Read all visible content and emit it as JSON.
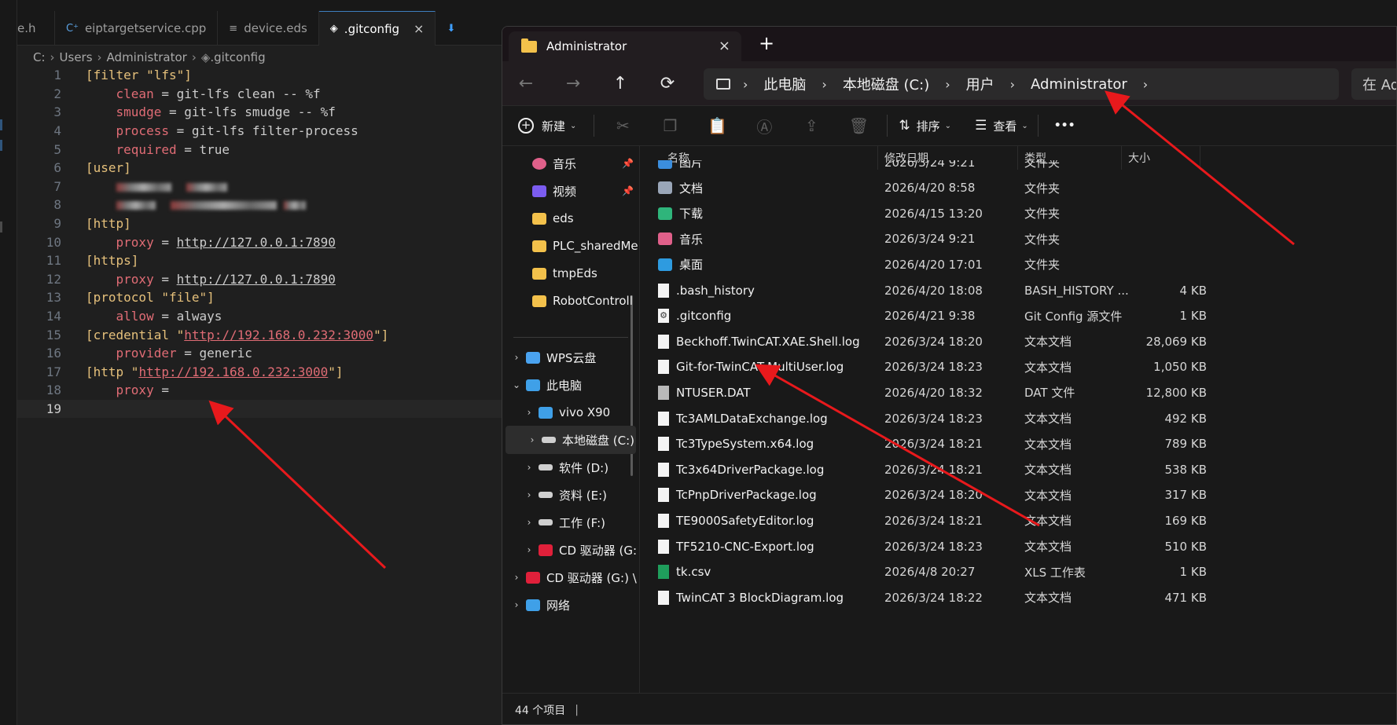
{
  "editor": {
    "tabs": [
      {
        "label": "e.h",
        "icon": "file-icon"
      },
      {
        "label": "eiptargetservice.cpp",
        "icon": "cpp-file-icon"
      },
      {
        "label": "device.eds",
        "icon": "text-file-icon"
      },
      {
        "label": ".gitconfig",
        "icon": "gitconfig-file-icon",
        "active": true,
        "close": "×"
      },
      {
        "label": "",
        "icon": "pin-icon"
      }
    ],
    "breadcrumb": [
      "C:",
      "Users",
      "Administrator",
      ".gitconfig"
    ],
    "lines": [
      {
        "n": "1",
        "parts": [
          [
            "k",
            "[filter \"lfs\"]"
          ]
        ]
      },
      {
        "n": "2",
        "parts": [
          [
            "v",
            "    clean"
          ],
          [
            "p",
            " = git-lfs clean -- %f"
          ]
        ]
      },
      {
        "n": "3",
        "parts": [
          [
            "v",
            "    smudge"
          ],
          [
            "p",
            " = git-lfs smudge -- %f"
          ]
        ]
      },
      {
        "n": "4",
        "parts": [
          [
            "v",
            "    process"
          ],
          [
            "p",
            " = git-lfs filter-process"
          ]
        ]
      },
      {
        "n": "5",
        "parts": [
          [
            "v",
            "    required"
          ],
          [
            "p",
            " = true"
          ]
        ]
      },
      {
        "n": "6",
        "parts": [
          [
            "k",
            "[user]"
          ]
        ]
      },
      {
        "n": "7",
        "parts": [
          [
            "blur",
            "    "
          ]
        ]
      },
      {
        "n": "8",
        "parts": [
          [
            "blur2",
            "    "
          ]
        ]
      },
      {
        "n": "9",
        "parts": [
          [
            "k",
            "[http]"
          ]
        ]
      },
      {
        "n": "10",
        "parts": [
          [
            "v",
            "    proxy"
          ],
          [
            "p",
            " = "
          ],
          [
            "u",
            "http://127.0.0.1:7890"
          ]
        ]
      },
      {
        "n": "11",
        "parts": [
          [
            "k",
            "[https]"
          ]
        ]
      },
      {
        "n": "12",
        "parts": [
          [
            "v",
            "    proxy"
          ],
          [
            "p",
            " = "
          ],
          [
            "u",
            "http://127.0.0.1:7890"
          ]
        ]
      },
      {
        "n": "13",
        "parts": [
          [
            "k",
            "[protocol \"file\"]"
          ]
        ]
      },
      {
        "n": "14",
        "parts": [
          [
            "v",
            "    allow"
          ],
          [
            "p",
            " = always"
          ]
        ]
      },
      {
        "n": "15",
        "parts": [
          [
            "k",
            "[credential \""
          ],
          [
            "uv",
            "http://192.168.0.232:3000"
          ],
          [
            "k",
            "\"]"
          ]
        ]
      },
      {
        "n": "16",
        "parts": [
          [
            "v",
            "    provider"
          ],
          [
            "p",
            " = generic"
          ]
        ]
      },
      {
        "n": "17",
        "parts": [
          [
            "k",
            "[http \""
          ],
          [
            "uv",
            "http://192.168.0.232:3000"
          ],
          [
            "k",
            "\"]"
          ]
        ]
      },
      {
        "n": "18",
        "parts": [
          [
            "v",
            "    proxy"
          ],
          [
            "p",
            " ="
          ]
        ]
      },
      {
        "n": "19",
        "parts": [],
        "current": true
      }
    ]
  },
  "explorer": {
    "window_tab": {
      "title": "Administrator",
      "close": "×",
      "new_tab": "+"
    },
    "address": [
      "此电脑",
      "本地磁盘 (C:)",
      "用户",
      "Administrator"
    ],
    "search_placeholder": "在 Ad",
    "toolbar": {
      "new": "新建",
      "sort": "排序",
      "view": "查看",
      "more": "•••"
    },
    "nav_items": [
      {
        "label": "音乐",
        "icon": "music-icon",
        "pinned": true
      },
      {
        "label": "视频",
        "icon": "video-icon",
        "pinned": true
      },
      {
        "label": "eds",
        "icon": "folder-icon"
      },
      {
        "label": "PLC_sharedMe",
        "icon": "folder-icon"
      },
      {
        "label": "tmpEds",
        "icon": "folder-icon"
      },
      {
        "label": "RobotControll",
        "icon": "folder-icon"
      },
      {
        "label": "WPS云盘",
        "icon": "cloud-icon",
        "expand": "›"
      },
      {
        "label": "此电脑",
        "icon": "computer-icon",
        "expand": "⌄"
      },
      {
        "label": "vivo X90",
        "icon": "phone-icon",
        "expand": "›"
      },
      {
        "label": "本地磁盘 (C:)",
        "icon": "drive-icon",
        "expand": "›",
        "selected": true
      },
      {
        "label": "软件 (D:)",
        "icon": "drive-icon",
        "expand": "›"
      },
      {
        "label": "资料 (E:)",
        "icon": "drive-icon",
        "expand": "›"
      },
      {
        "label": "工作 (F:)",
        "icon": "drive-icon",
        "expand": "›"
      },
      {
        "label": "CD 驱动器 (G:",
        "icon": "cd-drive-icon",
        "expand": "›"
      },
      {
        "label": "CD 驱动器 (G:) \\",
        "icon": "cd-drive-icon",
        "expand": "›"
      },
      {
        "label": "网络",
        "icon": "network-icon",
        "expand": "›"
      }
    ],
    "columns": [
      "名称",
      "修改日期",
      "类型",
      "大小"
    ],
    "files": [
      {
        "name": "图片",
        "date": "2026/3/24 9:21",
        "type": "文件夹",
        "size": "",
        "icon": "pictures-folder-icon"
      },
      {
        "name": "文档",
        "date": "2026/4/20 8:58",
        "type": "文件夹",
        "size": "",
        "icon": "documents-folder-icon"
      },
      {
        "name": "下载",
        "date": "2026/4/15 13:20",
        "type": "文件夹",
        "size": "",
        "icon": "downloads-folder-icon"
      },
      {
        "name": "音乐",
        "date": "2026/3/24 9:21",
        "type": "文件夹",
        "size": "",
        "icon": "music-folder-icon"
      },
      {
        "name": "桌面",
        "date": "2026/4/20 17:01",
        "type": "文件夹",
        "size": "",
        "icon": "desktop-folder-icon"
      },
      {
        "name": ".bash_history",
        "date": "2026/4/20 18:08",
        "type": "BASH_HISTORY ...",
        "size": "4 KB",
        "icon": "file-icon"
      },
      {
        "name": ".gitconfig",
        "date": "2026/4/21 9:38",
        "type": "Git Config 源文件",
        "size": "1 KB",
        "icon": "gear-file-icon"
      },
      {
        "name": "Beckhoff.TwinCAT.XAE.Shell.log",
        "date": "2026/3/24 18:20",
        "type": "文本文档",
        "size": "28,069 KB",
        "icon": "file-icon"
      },
      {
        "name": "Git-for-TwinCAT-MultiUser.log",
        "date": "2026/3/24 18:23",
        "type": "文本文档",
        "size": "1,050 KB",
        "icon": "file-icon"
      },
      {
        "name": "NTUSER.DAT",
        "date": "2026/4/20 18:32",
        "type": "DAT 文件",
        "size": "12,800 KB",
        "icon": "dat-file-icon"
      },
      {
        "name": "Tc3AMLDataExchange.log",
        "date": "2026/3/24 18:23",
        "type": "文本文档",
        "size": "492 KB",
        "icon": "file-icon"
      },
      {
        "name": "Tc3TypeSystem.x64.log",
        "date": "2026/3/24 18:21",
        "type": "文本文档",
        "size": "789 KB",
        "icon": "file-icon"
      },
      {
        "name": "Tc3x64DriverPackage.log",
        "date": "2026/3/24 18:21",
        "type": "文本文档",
        "size": "538 KB",
        "icon": "file-icon"
      },
      {
        "name": "TcPnpDriverPackage.log",
        "date": "2026/3/24 18:20",
        "type": "文本文档",
        "size": "317 KB",
        "icon": "file-icon"
      },
      {
        "name": "TE9000SafetyEditor.log",
        "date": "2026/3/24 18:21",
        "type": "文本文档",
        "size": "169 KB",
        "icon": "file-icon"
      },
      {
        "name": "TF5210-CNC-Export.log",
        "date": "2026/3/24 18:23",
        "type": "文本文档",
        "size": "510 KB",
        "icon": "file-icon"
      },
      {
        "name": "tk.csv",
        "date": "2026/4/8 20:27",
        "type": "XLS 工作表",
        "size": "1 KB",
        "icon": "spreadsheet-file-icon"
      },
      {
        "name": "TwinCAT 3 BlockDiagram.log",
        "date": "2026/3/24 18:22",
        "type": "文本文档",
        "size": "471 KB",
        "icon": "file-icon"
      }
    ],
    "status": "44 个项目"
  },
  "colors": {
    "annotation_arrow": "#e8191c",
    "accent": "#3f7fbf",
    "folder": "#f3c14b"
  }
}
